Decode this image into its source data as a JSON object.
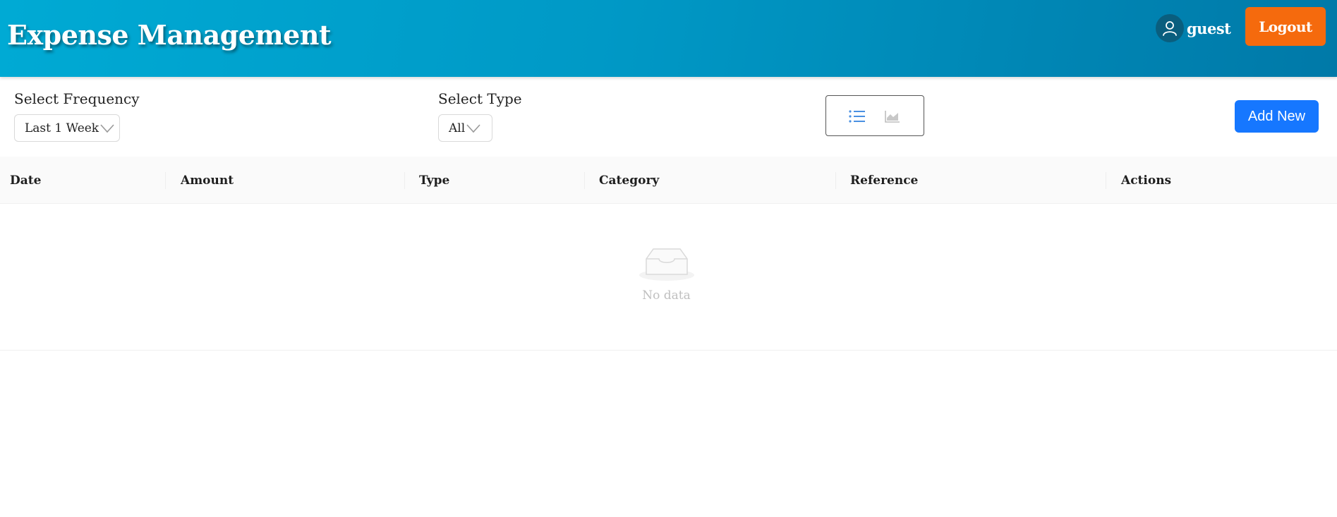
{
  "header": {
    "title": "Expense Management",
    "username": "guest",
    "logout_label": "Logout",
    "brand_color": "#00aad4",
    "logout_color": "#f56a0d"
  },
  "filters": {
    "frequency": {
      "label": "Select Frequency",
      "value": "Last 1 Week"
    },
    "type": {
      "label": "Select Type",
      "value": "All"
    }
  },
  "view_toggle": {
    "active": "list-view",
    "items": [
      "list-icon",
      "area-chart-icon"
    ]
  },
  "toolbar": {
    "add_new_label": "Add New",
    "accent_color": "#1677ff"
  },
  "table": {
    "columns": [
      "Date",
      "Amount",
      "Type",
      "Category",
      "Reference",
      "Actions"
    ],
    "rows": [],
    "empty_text": "No data"
  }
}
